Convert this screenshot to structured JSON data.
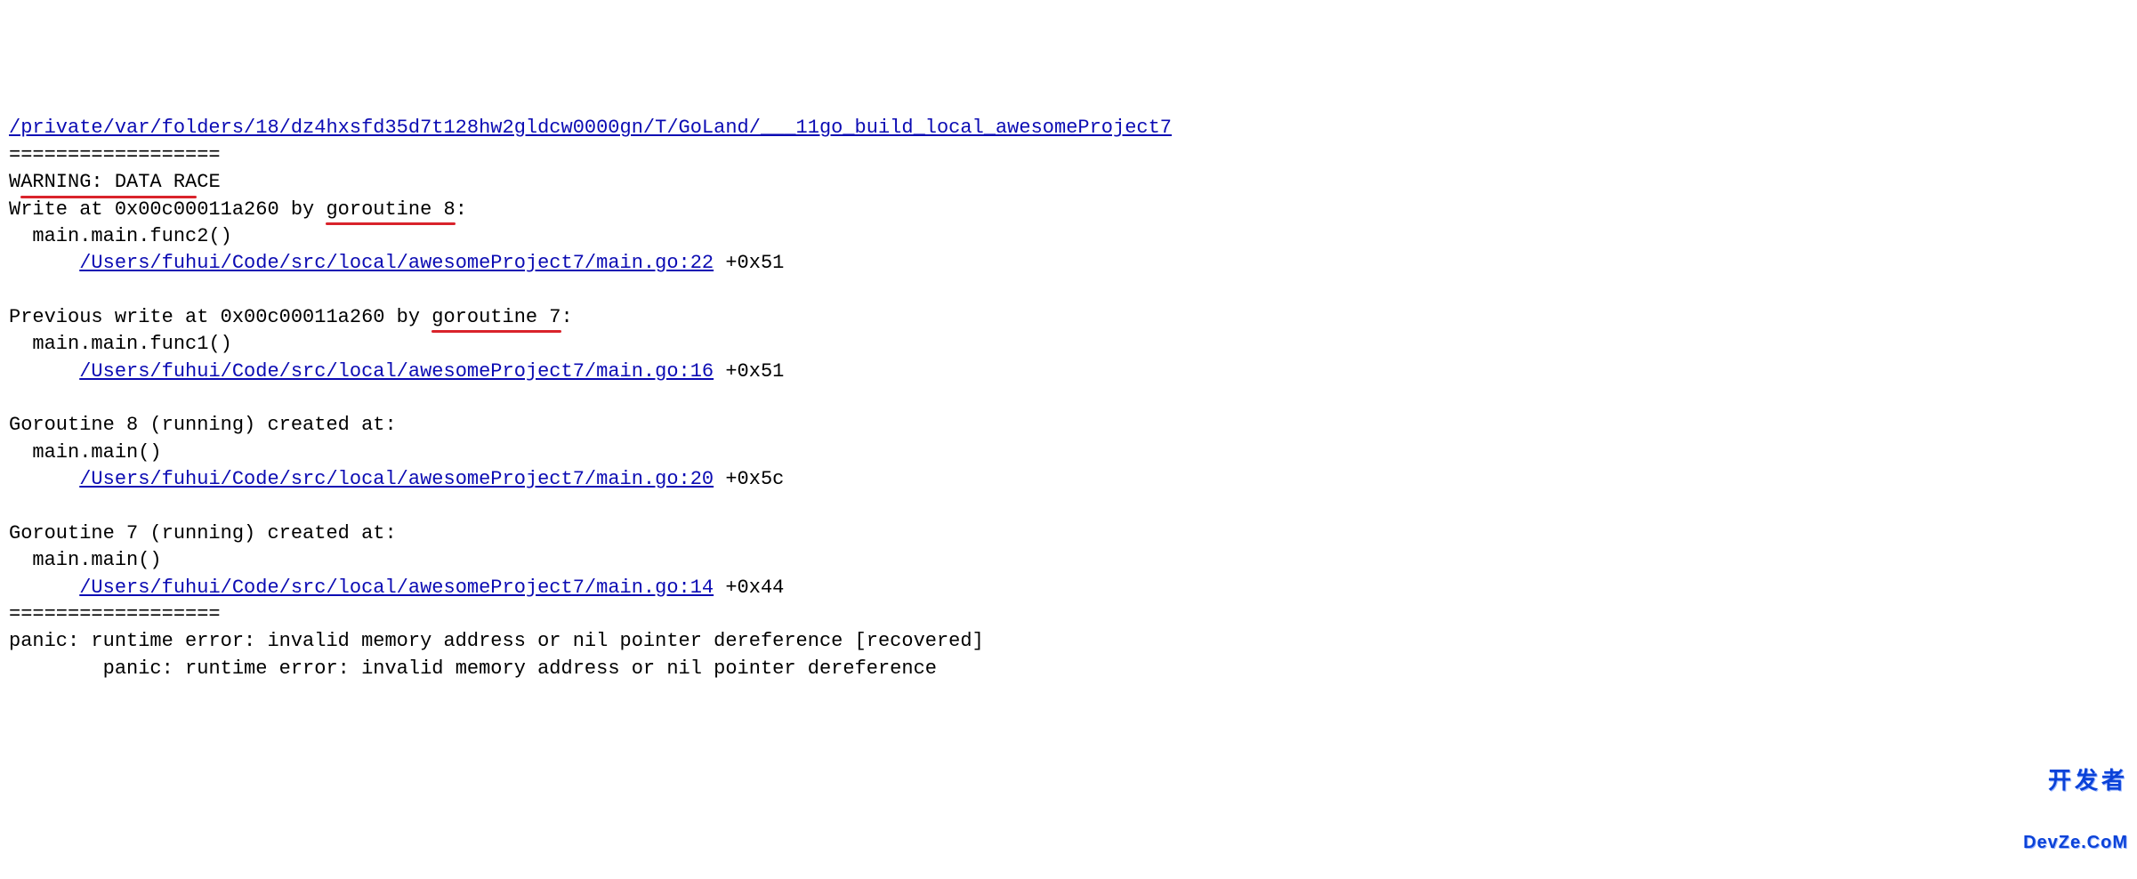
{
  "header_path": "/private/var/folders/18/dz4hxsfd35d7t128hw2gldcw0000gn/T/GoLand/___11go_build_local_awesomeProject7",
  "sep_top": "==================",
  "warning_prefix": "W",
  "warning_text": "ARNING: DATA RA",
  "warning_suffix": "CE",
  "write_line_a": "Write at 0x00c00011a260 by ",
  "write_line_goroutine": "goroutine 8",
  "write_line_b": ":",
  "func2_text": "main.main.func2()",
  "link1": "/Users/fuhui/Code/src/local/awesomeProject7/main.go:22",
  "off1": " +0x51",
  "prev_write_a": "Previous write at 0x00c00011a260 by ",
  "prev_write_goroutine": "goroutine 7",
  "prev_write_b": ":",
  "func1_text": "main.main.func1()",
  "link2": "/Users/fuhui/Code/src/local/awesomeProject7/main.go:16",
  "off2": " +0x51",
  "g8_created": "Goroutine 8 (running) created at:",
  "mainmain": "main.main()",
  "link3": "/Users/fuhui/Code/src/local/awesomeProject7/main.go:20",
  "off3": " +0x5c",
  "g7_created": "Goroutine 7 (running) created at:",
  "link4": "/Users/fuhui/Code/src/local/awesomeProject7/main.go:14",
  "off4": " +0x44",
  "sep_bottom": "==================",
  "panic1": "panic: runtime error: invalid memory address or nil pointer dereference [recovered]",
  "panic2": "panic: runtime error: invalid memory address or nil pointer dereference",
  "watermark_top": "开发者",
  "watermark_bottom": "DevZe.CoM",
  "indent2": "  ",
  "indent6": "      ",
  "indent8": "        "
}
